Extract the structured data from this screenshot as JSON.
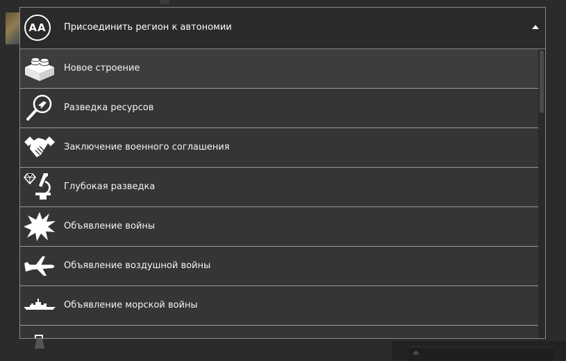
{
  "dropdown": {
    "badge_text": "AA",
    "selected_label": "Присоединить регион к автономии",
    "items": [
      {
        "label": "Новое строение",
        "icon": "brick-icon"
      },
      {
        "label": "Разведка ресурсов",
        "icon": "magnifier-resource-icon"
      },
      {
        "label": "Заключение военного соглашения",
        "icon": "handshake-icon"
      },
      {
        "label": "Глубокая разведка",
        "icon": "diamond-microscope-icon"
      },
      {
        "label": "Объявление войны",
        "icon": "explosion-icon"
      },
      {
        "label": "Объявление воздушной войны",
        "icon": "airplane-icon"
      },
      {
        "label": "Объявление морской войны",
        "icon": "warship-icon"
      },
      {
        "label": "",
        "icon": "tower-icon"
      }
    ]
  },
  "colors": {
    "background": "#2b2b2b",
    "header_bg": "#2a2a2a",
    "item_bg": "#353535",
    "border": "#8a8a8a",
    "text": "#ffffff"
  }
}
